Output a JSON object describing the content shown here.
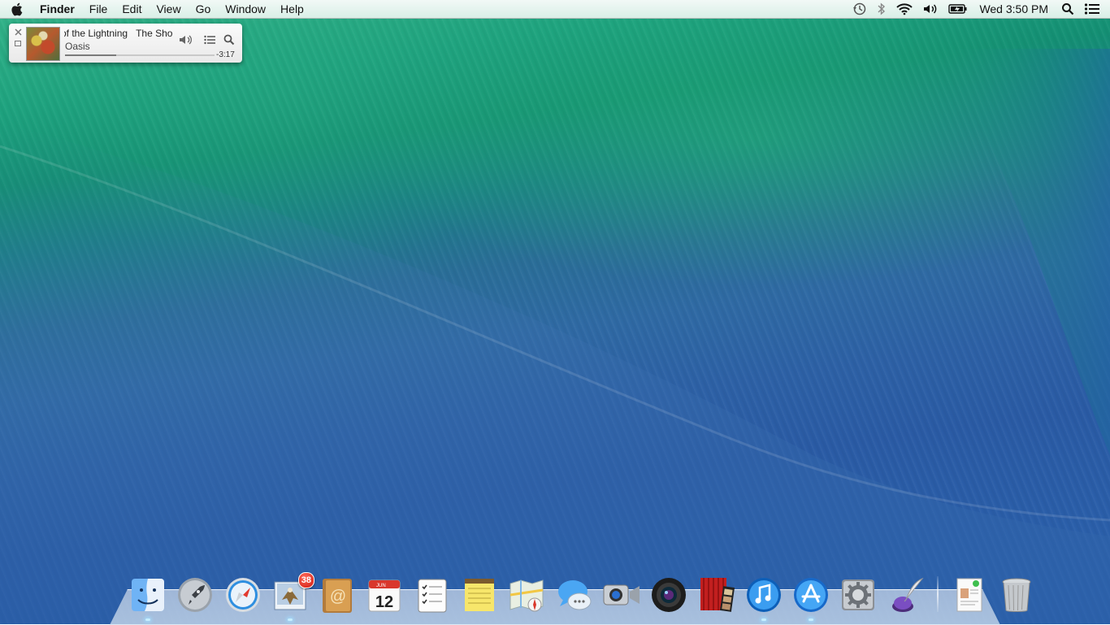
{
  "menubar": {
    "apple_icon": "apple-logo-icon",
    "app_name": "Finder",
    "items": [
      "File",
      "Edit",
      "View",
      "Go",
      "Window",
      "Help"
    ],
    "status_icons": [
      "time-machine-icon",
      "bluetooth-icon",
      "wifi-icon",
      "volume-icon",
      "battery-icon"
    ],
    "clock": "Wed 3:50 PM",
    "spotlight_icon": "spotlight-search-icon",
    "notification_icon": "notification-center-icon"
  },
  "miniplayer": {
    "track_title": "of the Lightning",
    "track_next": "The Sho",
    "artist": "Oasis",
    "time_remaining": "-3:17",
    "progress_fraction": 0.34
  },
  "dock": {
    "apps": [
      {
        "name": "Finder",
        "icon": "finder-icon",
        "running": true
      },
      {
        "name": "Launchpad",
        "icon": "launchpad-icon",
        "running": false
      },
      {
        "name": "Safari",
        "icon": "safari-icon",
        "running": false
      },
      {
        "name": "Mail",
        "icon": "mail-icon",
        "running": true,
        "badge": "38"
      },
      {
        "name": "Contacts",
        "icon": "contacts-icon",
        "running": false
      },
      {
        "name": "Calendar",
        "icon": "calendar-icon",
        "running": false,
        "month": "JUN",
        "day": "12"
      },
      {
        "name": "Reminders",
        "icon": "reminders-icon",
        "running": false
      },
      {
        "name": "Notes",
        "icon": "notes-icon",
        "running": false
      },
      {
        "name": "Maps",
        "icon": "maps-icon",
        "running": false
      },
      {
        "name": "Messages",
        "icon": "messages-icon",
        "running": false
      },
      {
        "name": "FaceTime",
        "icon": "facetime-icon",
        "running": false
      },
      {
        "name": "Photo Booth",
        "icon": "photo-booth-icon",
        "running": false
      },
      {
        "name": "Photo Booth Reel",
        "icon": "photo-reel-icon",
        "running": false
      },
      {
        "name": "iTunes",
        "icon": "itunes-icon",
        "running": true
      },
      {
        "name": "App Store",
        "icon": "app-store-icon",
        "running": true
      },
      {
        "name": "System Preferences",
        "icon": "system-preferences-icon",
        "running": false
      },
      {
        "name": "Script Editor",
        "icon": "quill-icon",
        "running": false
      }
    ],
    "stack_icon": "document-stack-icon",
    "trash_icon": "trash-icon"
  }
}
